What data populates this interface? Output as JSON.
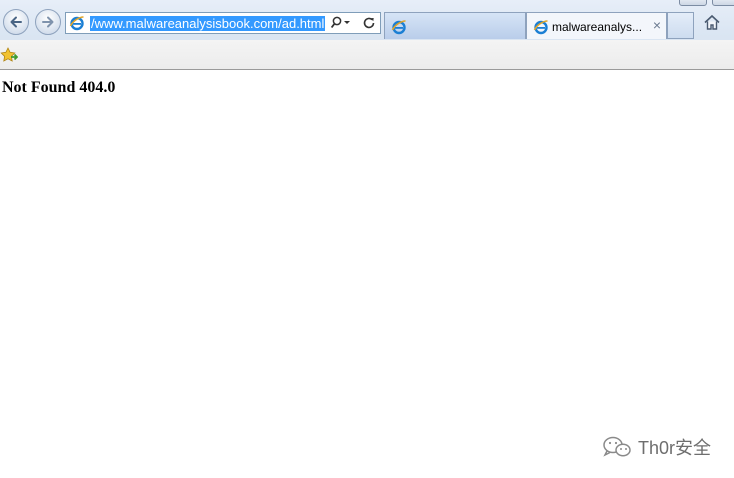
{
  "browser": {
    "address_bar": {
      "url": "/www.malwareanalysisbook.com/ad.html"
    },
    "tabs": [
      {
        "label": "",
        "icon": "ie-icon"
      },
      {
        "label": "malwareanalys...",
        "icon": "ie-icon",
        "close": "×"
      }
    ],
    "colors": {
      "selection": "#3399ff",
      "chrome": "#dbe6f3"
    }
  },
  "page": {
    "title": "Not Found 404.0"
  },
  "watermark": {
    "text": "Th0r安全",
    "icon": "wechat-icon"
  }
}
